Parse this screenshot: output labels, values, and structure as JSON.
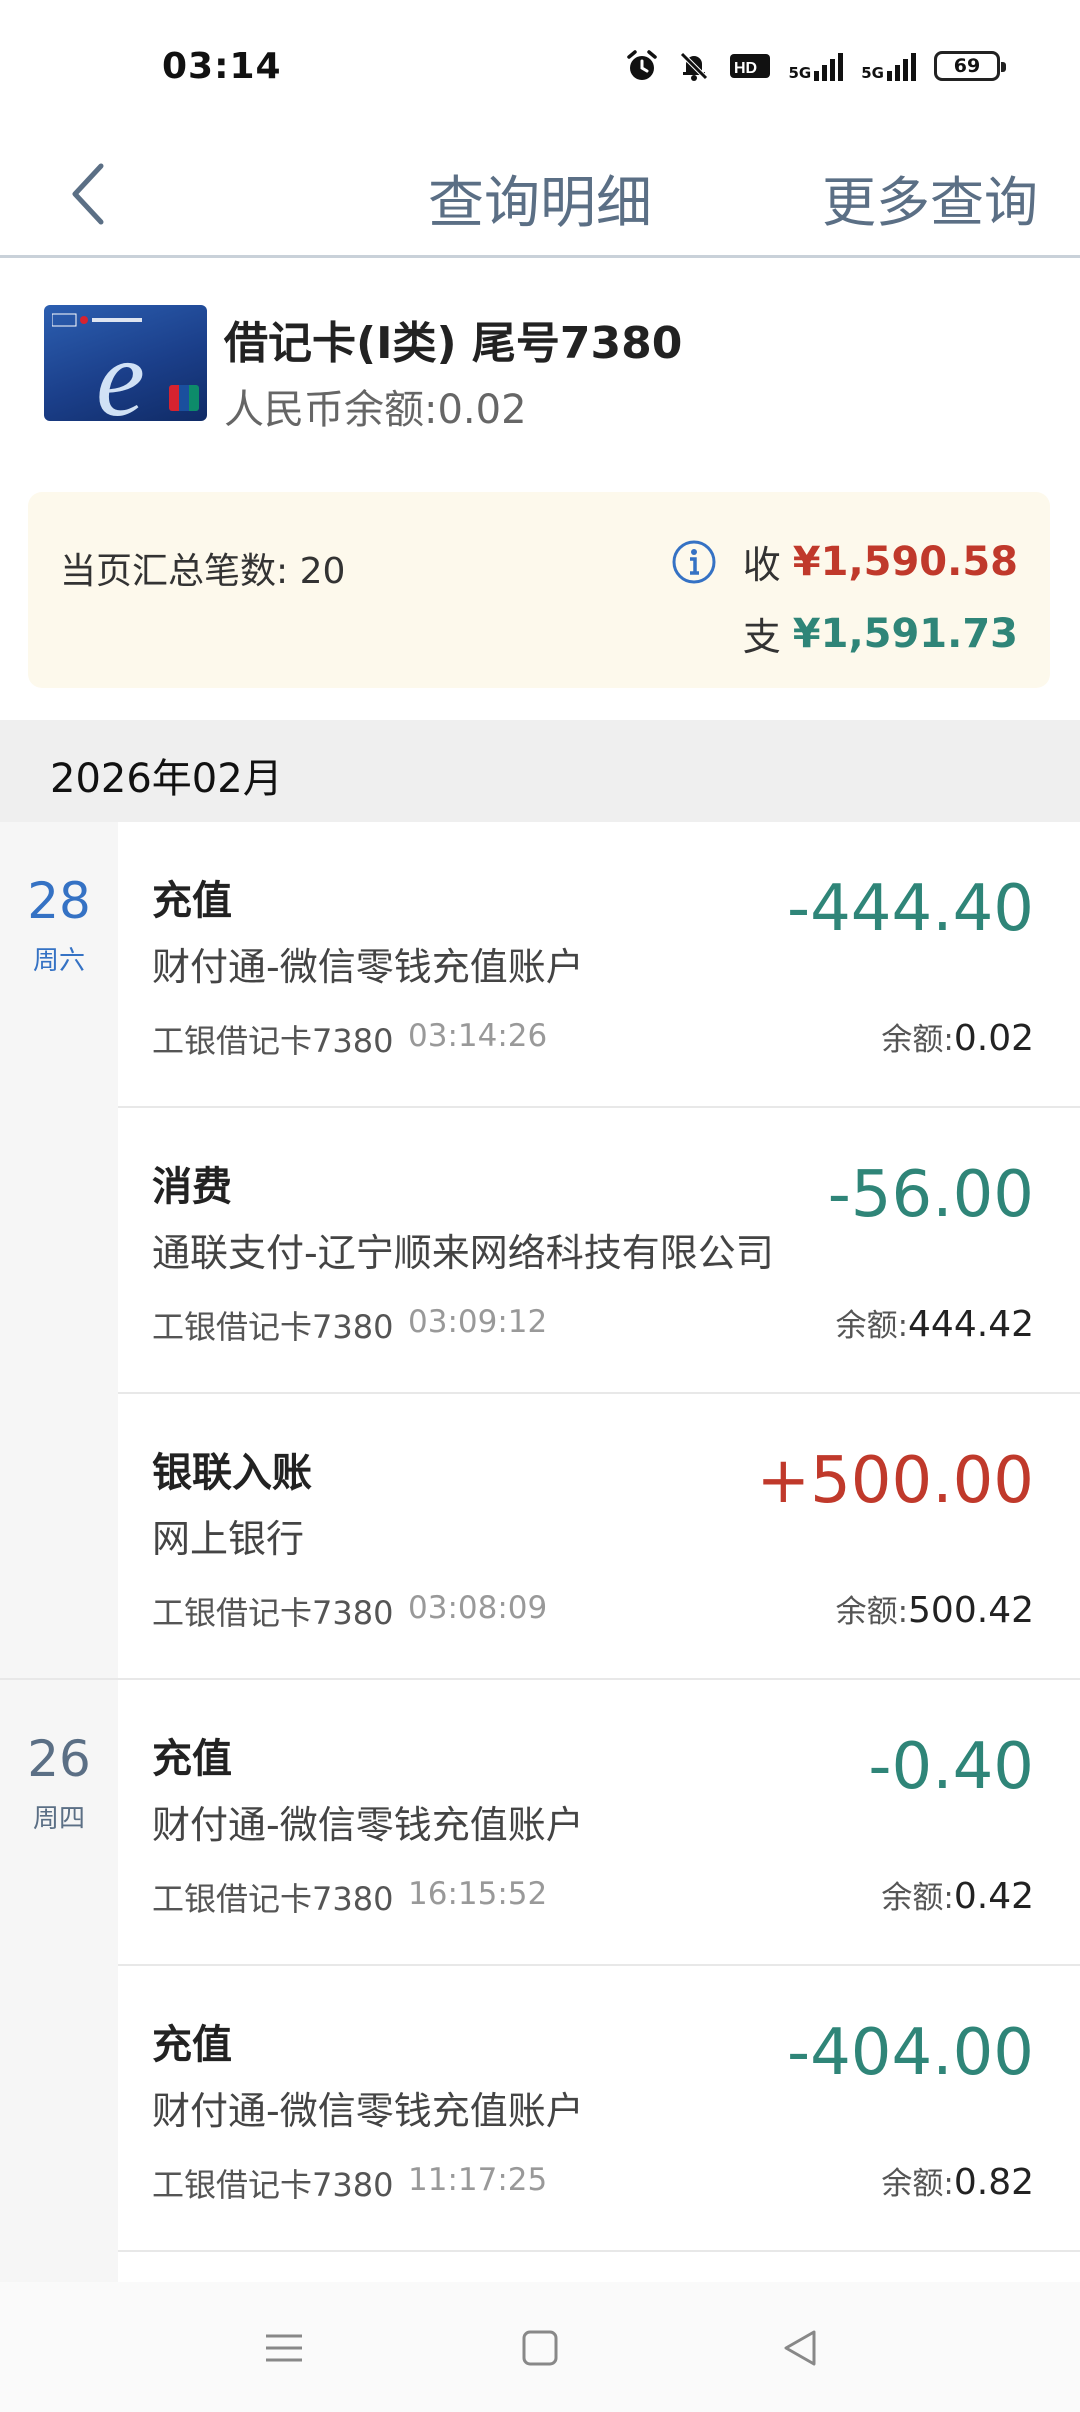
{
  "status": {
    "time": "03:14",
    "network1": "5G",
    "network2": "5G",
    "battery": "69"
  },
  "header": {
    "title": "查询明细",
    "more": "更多查询"
  },
  "card": {
    "name": "借记卡(I类) 尾号7380",
    "balance": "人民币余额:0.02"
  },
  "summary": {
    "count": "当页汇总笔数: 20",
    "in_label": "收",
    "in_amount": "¥1,590.58",
    "out_label": "支",
    "out_amount": "¥1,591.73"
  },
  "month": "2026年02月",
  "days": [
    {
      "day": "28",
      "weekday": "周六"
    },
    {
      "day": "26",
      "weekday": "周四"
    }
  ],
  "transactions": [
    {
      "type": "充值",
      "party": "财付通-微信零钱充值账户",
      "card": "工银借记卡7380",
      "time": "03:14:26",
      "amount": "-444.40",
      "balance_label": "余额:",
      "balance": "0.02"
    },
    {
      "type": "消费",
      "party": "通联支付-辽宁顺来网络科技有限公司",
      "card": "工银借记卡7380",
      "time": "03:09:12",
      "amount": "-56.00",
      "balance_label": "余额:",
      "balance": "444.42"
    },
    {
      "type": "银联入账",
      "party": "网上银行",
      "card": "工银借记卡7380",
      "time": "03:08:09",
      "amount": "+500.00",
      "balance_label": "余额:",
      "balance": "500.42"
    },
    {
      "type": "充值",
      "party": "财付通-微信零钱充值账户",
      "card": "工银借记卡7380",
      "time": "16:15:52",
      "amount": "-0.40",
      "balance_label": "余额:",
      "balance": "0.42"
    },
    {
      "type": "充值",
      "party": "财付通-微信零钱充值账户",
      "card": "工银借记卡7380",
      "time": "11:17:25",
      "amount": "-404.00",
      "balance_label": "余额:",
      "balance": "0.82"
    }
  ],
  "colors": {
    "header_text": "#5b6f85",
    "expense": "#2f8578",
    "income": "#c0392b",
    "day_active": "#3572c4",
    "summary_bg": "#fdf9ec"
  }
}
